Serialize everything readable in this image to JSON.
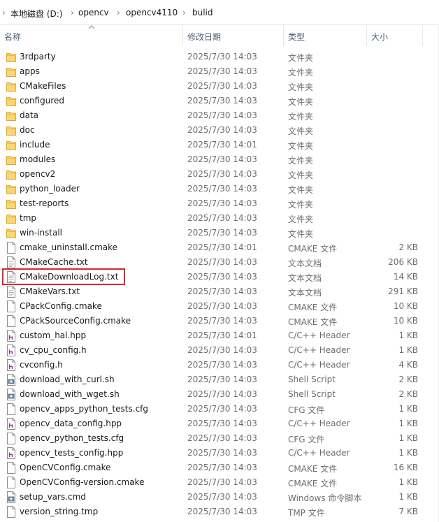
{
  "breadcrumb": {
    "drive": "本地磁盘 (D:)",
    "segments": [
      "opencv",
      "opencv4110",
      "bulid"
    ]
  },
  "columns": {
    "name": "名称",
    "date": "修改日期",
    "type": "类型",
    "size": "大小"
  },
  "sort": {
    "column": "name",
    "direction": "ascending"
  },
  "highlight": {
    "file": "CMakeDownloadLog.txt",
    "color": "#e0252d"
  },
  "files": [
    {
      "name": "3rdparty",
      "date": "2025/7/30 14:03",
      "type": "文件夹",
      "size": "",
      "icon": "folder-icon"
    },
    {
      "name": "apps",
      "date": "2025/7/30 14:03",
      "type": "文件夹",
      "size": "",
      "icon": "folder-icon"
    },
    {
      "name": "CMakeFiles",
      "date": "2025/7/30 14:03",
      "type": "文件夹",
      "size": "",
      "icon": "folder-icon"
    },
    {
      "name": "configured",
      "date": "2025/7/30 14:03",
      "type": "文件夹",
      "size": "",
      "icon": "folder-icon"
    },
    {
      "name": "data",
      "date": "2025/7/30 14:03",
      "type": "文件夹",
      "size": "",
      "icon": "folder-icon"
    },
    {
      "name": "doc",
      "date": "2025/7/30 14:03",
      "type": "文件夹",
      "size": "",
      "icon": "folder-icon"
    },
    {
      "name": "include",
      "date": "2025/7/30 14:01",
      "type": "文件夹",
      "size": "",
      "icon": "folder-icon"
    },
    {
      "name": "modules",
      "date": "2025/7/30 14:03",
      "type": "文件夹",
      "size": "",
      "icon": "folder-icon"
    },
    {
      "name": "opencv2",
      "date": "2025/7/30 14:03",
      "type": "文件夹",
      "size": "",
      "icon": "folder-icon"
    },
    {
      "name": "python_loader",
      "date": "2025/7/30 14:03",
      "type": "文件夹",
      "size": "",
      "icon": "folder-icon"
    },
    {
      "name": "test-reports",
      "date": "2025/7/30 14:03",
      "type": "文件夹",
      "size": "",
      "icon": "folder-icon"
    },
    {
      "name": "tmp",
      "date": "2025/7/30 14:03",
      "type": "文件夹",
      "size": "",
      "icon": "folder-icon"
    },
    {
      "name": "win-install",
      "date": "2025/7/30 14:03",
      "type": "文件夹",
      "size": "",
      "icon": "folder-icon"
    },
    {
      "name": "cmake_uninstall.cmake",
      "date": "2025/7/30 14:01",
      "type": "CMAKE 文件",
      "size": "2 KB",
      "icon": "file-icon"
    },
    {
      "name": "CMakeCache.txt",
      "date": "2025/7/30 14:03",
      "type": "文本文档",
      "size": "206 KB",
      "icon": "text-file-icon"
    },
    {
      "name": "CMakeDownloadLog.txt",
      "date": "2025/7/30 14:03",
      "type": "文本文档",
      "size": "14 KB",
      "icon": "text-file-icon"
    },
    {
      "name": "CMakeVars.txt",
      "date": "2025/7/30 14:03",
      "type": "文本文档",
      "size": "291 KB",
      "icon": "text-file-icon"
    },
    {
      "name": "CPackConfig.cmake",
      "date": "2025/7/30 14:03",
      "type": "CMAKE 文件",
      "size": "10 KB",
      "icon": "file-icon"
    },
    {
      "name": "CPackSourceConfig.cmake",
      "date": "2025/7/30 14:03",
      "type": "CMAKE 文件",
      "size": "10 KB",
      "icon": "file-icon"
    },
    {
      "name": "custom_hal.hpp",
      "date": "2025/7/30 14:01",
      "type": "C/C++ Header",
      "size": "1 KB",
      "icon": "header-file-icon"
    },
    {
      "name": "cv_cpu_config.h",
      "date": "2025/7/30 14:03",
      "type": "C/C++ Header",
      "size": "1 KB",
      "icon": "header-file-icon"
    },
    {
      "name": "cvconfig.h",
      "date": "2025/7/30 14:03",
      "type": "C/C++ Header",
      "size": "4 KB",
      "icon": "header-file-icon"
    },
    {
      "name": "download_with_curl.sh",
      "date": "2025/7/30 14:03",
      "type": "Shell Script",
      "size": "2 KB",
      "icon": "script-file-icon"
    },
    {
      "name": "download_with_wget.sh",
      "date": "2025/7/30 14:03",
      "type": "Shell Script",
      "size": "2 KB",
      "icon": "script-file-icon"
    },
    {
      "name": "opencv_apps_python_tests.cfg",
      "date": "2025/7/30 14:03",
      "type": "CFG 文件",
      "size": "1 KB",
      "icon": "file-icon"
    },
    {
      "name": "opencv_data_config.hpp",
      "date": "2025/7/30 14:03",
      "type": "C/C++ Header",
      "size": "1 KB",
      "icon": "header-file-icon"
    },
    {
      "name": "opencv_python_tests.cfg",
      "date": "2025/7/30 14:03",
      "type": "CFG 文件",
      "size": "1 KB",
      "icon": "file-icon"
    },
    {
      "name": "opencv_tests_config.hpp",
      "date": "2025/7/30 14:03",
      "type": "C/C++ Header",
      "size": "1 KB",
      "icon": "header-file-icon"
    },
    {
      "name": "OpenCVConfig.cmake",
      "date": "2025/7/30 14:03",
      "type": "CMAKE 文件",
      "size": "16 KB",
      "icon": "file-icon"
    },
    {
      "name": "OpenCVConfig-version.cmake",
      "date": "2025/7/30 14:03",
      "type": "CMAKE 文件",
      "size": "1 KB",
      "icon": "file-icon"
    },
    {
      "name": "setup_vars.cmd",
      "date": "2025/7/30 14:03",
      "type": "Windows 命令脚本",
      "size": "1 KB",
      "icon": "script-file-icon"
    },
    {
      "name": "version_string.tmp",
      "date": "2025/7/30 14:03",
      "type": "TMP 文件",
      "size": "7 KB",
      "icon": "file-icon"
    }
  ]
}
